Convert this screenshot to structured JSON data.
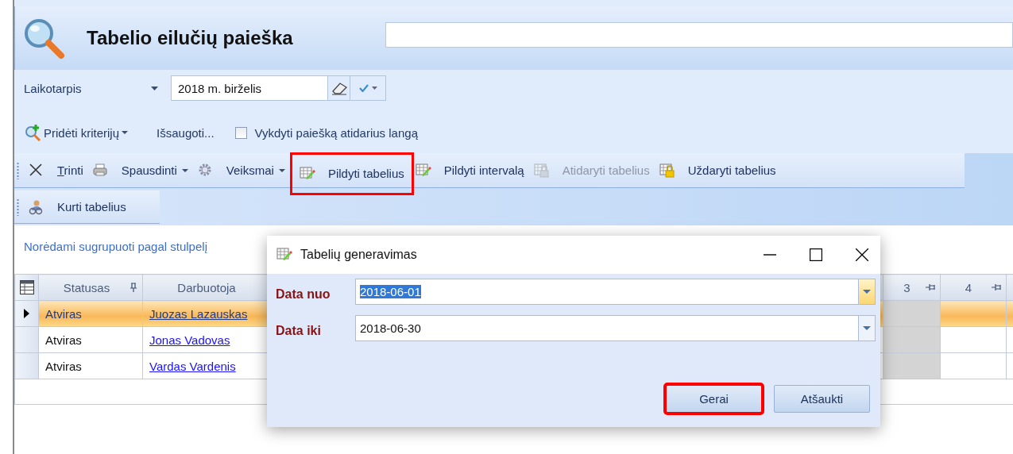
{
  "header": {
    "title": "Tabelio eilučių paieška"
  },
  "filters": {
    "period_label": "Laikotarpis",
    "period_value": "2018 m. birželis",
    "add_criteria": "Pridėti kriterijų",
    "save": "Išsaugoti...",
    "run_on_open": {
      "label": "Vykdyti paiešką atidarius langą",
      "checked": false
    }
  },
  "toolbar": [
    {
      "label": "Trinti",
      "kind": "delete",
      "mnemonic": true,
      "dropdown": false,
      "disabled": false,
      "highlighted": false
    },
    {
      "label": "Spausdinti",
      "kind": "print",
      "mnemonic": false,
      "dropdown": true,
      "disabled": false,
      "highlighted": false
    },
    {
      "label": "Veiksmai",
      "kind": "gear",
      "mnemonic": false,
      "dropdown": true,
      "disabled": false,
      "highlighted": false
    },
    {
      "label": "Pildyti tabelius",
      "kind": "fill",
      "mnemonic": false,
      "dropdown": false,
      "disabled": false,
      "highlighted": true
    },
    {
      "label": "Pildyti intervalą",
      "kind": "fill",
      "mnemonic": false,
      "dropdown": false,
      "disabled": false,
      "highlighted": false
    },
    {
      "label": "Atidaryti tabelius",
      "kind": "lock",
      "mnemonic": false,
      "dropdown": false,
      "disabled": true,
      "highlighted": false
    },
    {
      "label": "Uždaryti tabelius",
      "kind": "lock",
      "mnemonic": false,
      "dropdown": false,
      "disabled": false,
      "highlighted": false
    }
  ],
  "toolbar2": [
    {
      "label": "Kurti tabelius",
      "kind": "people"
    }
  ],
  "group_hint": "Norėdami sugrupuoti pagal stulpelį",
  "table": {
    "columns": [
      {
        "kind": "status",
        "label": "Statusas",
        "pinned": true
      },
      {
        "kind": "employee",
        "label": "Darbuotoja"
      },
      {
        "kind": "day",
        "label": "3",
        "pinned": true,
        "weekend": true
      },
      {
        "kind": "day",
        "label": "4",
        "pinned": true,
        "weekend": false
      }
    ],
    "rows": [
      {
        "status": "Atviras",
        "employee": "Juozas Lazauskas",
        "selected": true
      },
      {
        "status": "Atviras",
        "employee": "Jonas  Vadovas",
        "selected": false
      },
      {
        "status": "Atviras",
        "employee": "Vardas Vardenis",
        "selected": false
      }
    ]
  },
  "dialog": {
    "title": "Tabelių generavimas",
    "fields": [
      {
        "label": "Data nuo",
        "value": "2018-06-01",
        "focused": true
      },
      {
        "label": "Data iki",
        "value": "2018-06-30",
        "focused": false
      }
    ],
    "buttons": [
      {
        "label": "Gerai",
        "highlighted": true
      },
      {
        "label": "Atšaukti",
        "highlighted": false
      }
    ]
  }
}
